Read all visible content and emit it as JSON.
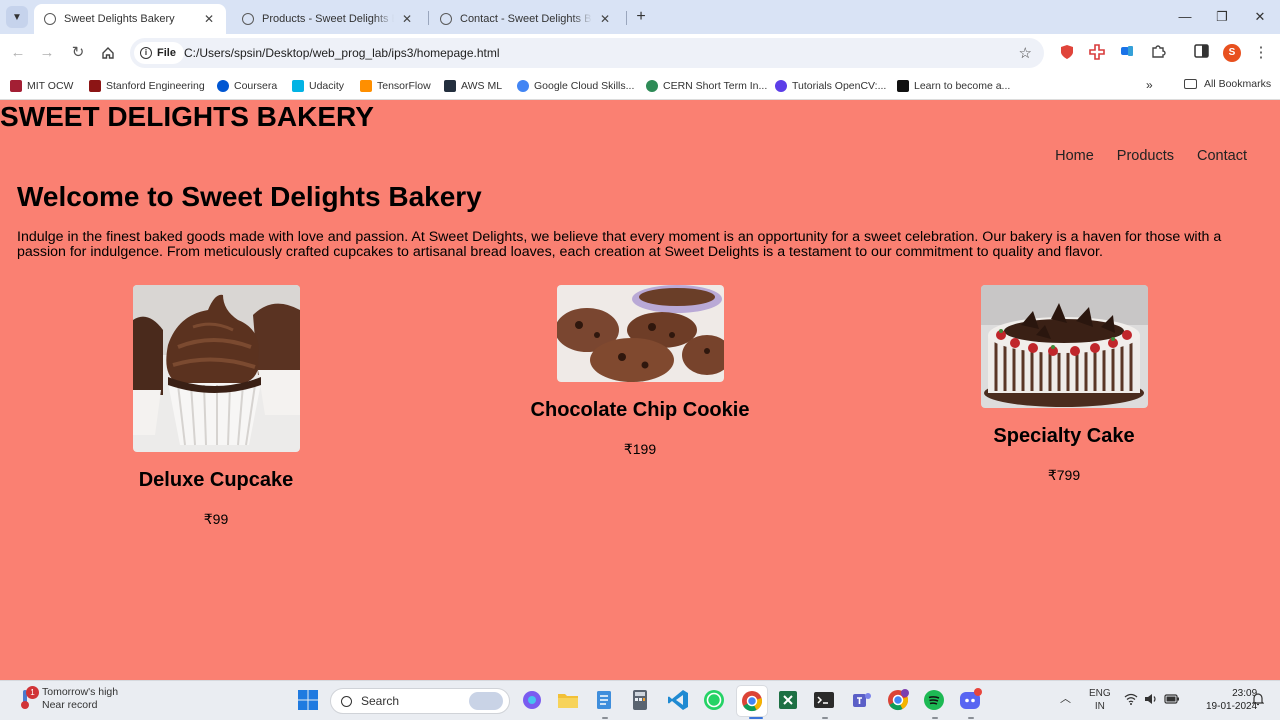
{
  "browser": {
    "tabs": [
      {
        "title": "Sweet Delights Bakery",
        "active": true
      },
      {
        "title": "Products - Sweet Delights Bakery",
        "active": false
      },
      {
        "title": "Contact - Sweet Delights Bakery",
        "active": false
      }
    ],
    "chip_label": "File",
    "url": "C:/Users/spsin/Desktop/web_prog_lab/ips3/homepage.html",
    "profile_initial": "S",
    "bookmarks": [
      {
        "label": "MIT OCW",
        "color": "#a31f34"
      },
      {
        "label": "Stanford Engineering",
        "color": "#8c1515"
      },
      {
        "label": "Coursera",
        "color": "#0056d2"
      },
      {
        "label": "Udacity",
        "color": "#02b3e4"
      },
      {
        "label": "TensorFlow",
        "color": "#ff8f00"
      },
      {
        "label": "AWS ML",
        "color": "#232f3e"
      },
      {
        "label": "Google Cloud Skills...",
        "color": "#4285f4"
      },
      {
        "label": "CERN Short Term In...",
        "color": "#2e8b57"
      },
      {
        "label": "Tutorials OpenCV:...",
        "color": "#5c3ee8"
      },
      {
        "label": "Learn to become a...",
        "color": "#111111"
      }
    ],
    "bookmarks_more": "»",
    "all_bookmarks": "All Bookmarks"
  },
  "page": {
    "site_title": "SWEET DELIGHTS BAKERY",
    "nav": [
      "Home",
      "Products",
      "Contact"
    ],
    "heading": "Welcome to Sweet Delights Bakery",
    "intro": "Indulge in the finest baked goods made with love and passion. At Sweet Delights, we believe that every moment is an opportunity for a sweet celebration. Our bakery is a haven for those with a passion for indulgence. From meticulously crafted cupcakes to artisanal bread loaves, each creation at Sweet Delights is a testament to our commitment to quality and flavor.",
    "products": [
      {
        "name": "Deluxe Cupcake",
        "price": "₹99"
      },
      {
        "name": "Chocolate Chip Cookie",
        "price": "₹199"
      },
      {
        "name": "Specialty Cake",
        "price": "₹799"
      }
    ],
    "background_color": "#fa8072"
  },
  "taskbar": {
    "weather_badge": "1",
    "weather_line1": "Tomorrow's high",
    "weather_line2": "Near record",
    "search_label": "Search",
    "lang_line1": "ENG",
    "lang_line2": "IN",
    "time": "23:09",
    "date": "19-01-2024"
  }
}
